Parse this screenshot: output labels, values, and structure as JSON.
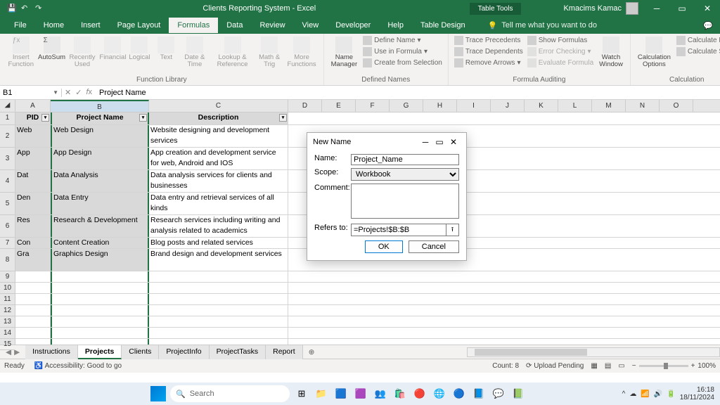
{
  "titlebar": {
    "title": "Clients Reporting System  -  Excel",
    "tabletools": "Table Tools",
    "user": "Kmacims Kamac"
  },
  "ribbonTabs": [
    "File",
    "Home",
    "Insert",
    "Page Layout",
    "Formulas",
    "Data",
    "Review",
    "View",
    "Developer",
    "Help",
    "Table Design"
  ],
  "activeTab": "Formulas",
  "tellMe": "Tell me what you want to do",
  "ribbon": {
    "fnlib": {
      "label": "Function Library",
      "btns": [
        "Insert\nFunction",
        "AutoSum",
        "Recently\nUsed",
        "Financial",
        "Logical",
        "Text",
        "Date &\nTime",
        "Lookup &\nReference",
        "Math &\nTrig",
        "More\nFunctions"
      ]
    },
    "defnames": {
      "label": "Defined Names",
      "big": "Name\nManager",
      "items": [
        "Define Name",
        "Use in Formula",
        "Create from Selection"
      ]
    },
    "formaudit": {
      "label": "Formula Auditing",
      "left": [
        "Trace Precedents",
        "Trace Dependents",
        "Remove Arrows"
      ],
      "right": [
        "Show Formulas",
        "Error Checking",
        "Evaluate Formula"
      ],
      "big": "Watch\nWindow"
    },
    "calc": {
      "label": "Calculation",
      "big": "Calculation\nOptions",
      "items": [
        "Calculate Now",
        "Calculate Sheet"
      ]
    }
  },
  "formulabar": {
    "namebox": "B1",
    "value": "Project Name"
  },
  "columns": [
    "A",
    "B",
    "C",
    "D",
    "E",
    "F",
    "G",
    "H",
    "I",
    "J",
    "K",
    "L",
    "M",
    "N",
    "O"
  ],
  "headers": {
    "pid": "PID",
    "pname": "Project Name",
    "desc": "Description"
  },
  "rows": [
    {
      "r": 2,
      "pid": "Web",
      "pname": "Web Design",
      "desc": "Website designing and development services",
      "multi": true
    },
    {
      "r": 3,
      "pid": "App",
      "pname": "App Design",
      "desc": "App creation and development service for web, Android and IOS",
      "multi": true
    },
    {
      "r": 4,
      "pid": "Dat",
      "pname": "Data Analysis",
      "desc": "Data analysis services for clients and businesses",
      "multi": true
    },
    {
      "r": 5,
      "pid": "Den",
      "pname": "Data Entry",
      "desc": "Data entry and retrieval services of all kinds",
      "multi": true
    },
    {
      "r": 6,
      "pid": "Res",
      "pname": "Research & Development",
      "desc": "Research services including writing and analysis related to academics",
      "multi": true
    },
    {
      "r": 7,
      "pid": "Con",
      "pname": "Content Creation",
      "desc": "Blog posts and related services",
      "multi": false
    },
    {
      "r": 8,
      "pid": "Gra",
      "pname": "Graphics Design",
      "desc": "Brand design and development services",
      "multi": true
    }
  ],
  "emptyRows": [
    9,
    10,
    11,
    12,
    13,
    14,
    15
  ],
  "sheets": [
    "Instructions",
    "Projects",
    "Clients",
    "ProjectInfo",
    "ProjectTasks",
    "Report"
  ],
  "activeSheet": "Projects",
  "status": {
    "ready": "Ready",
    "access": "Accessibility: Good to go",
    "count": "Count: 8",
    "upload": "Upload Pending",
    "zoom": "100%"
  },
  "dialog": {
    "title": "New Name",
    "nameLabel": "Name:",
    "nameValue": "Project_Name",
    "scopeLabel": "Scope:",
    "scopeValue": "Workbook",
    "commentLabel": "Comment:",
    "refersLabel": "Refers to:",
    "refersValue": "=Projects!$B:$B",
    "ok": "OK",
    "cancel": "Cancel"
  },
  "taskbar": {
    "search": "Search",
    "time": "16:18",
    "date": "18/11/2024"
  }
}
